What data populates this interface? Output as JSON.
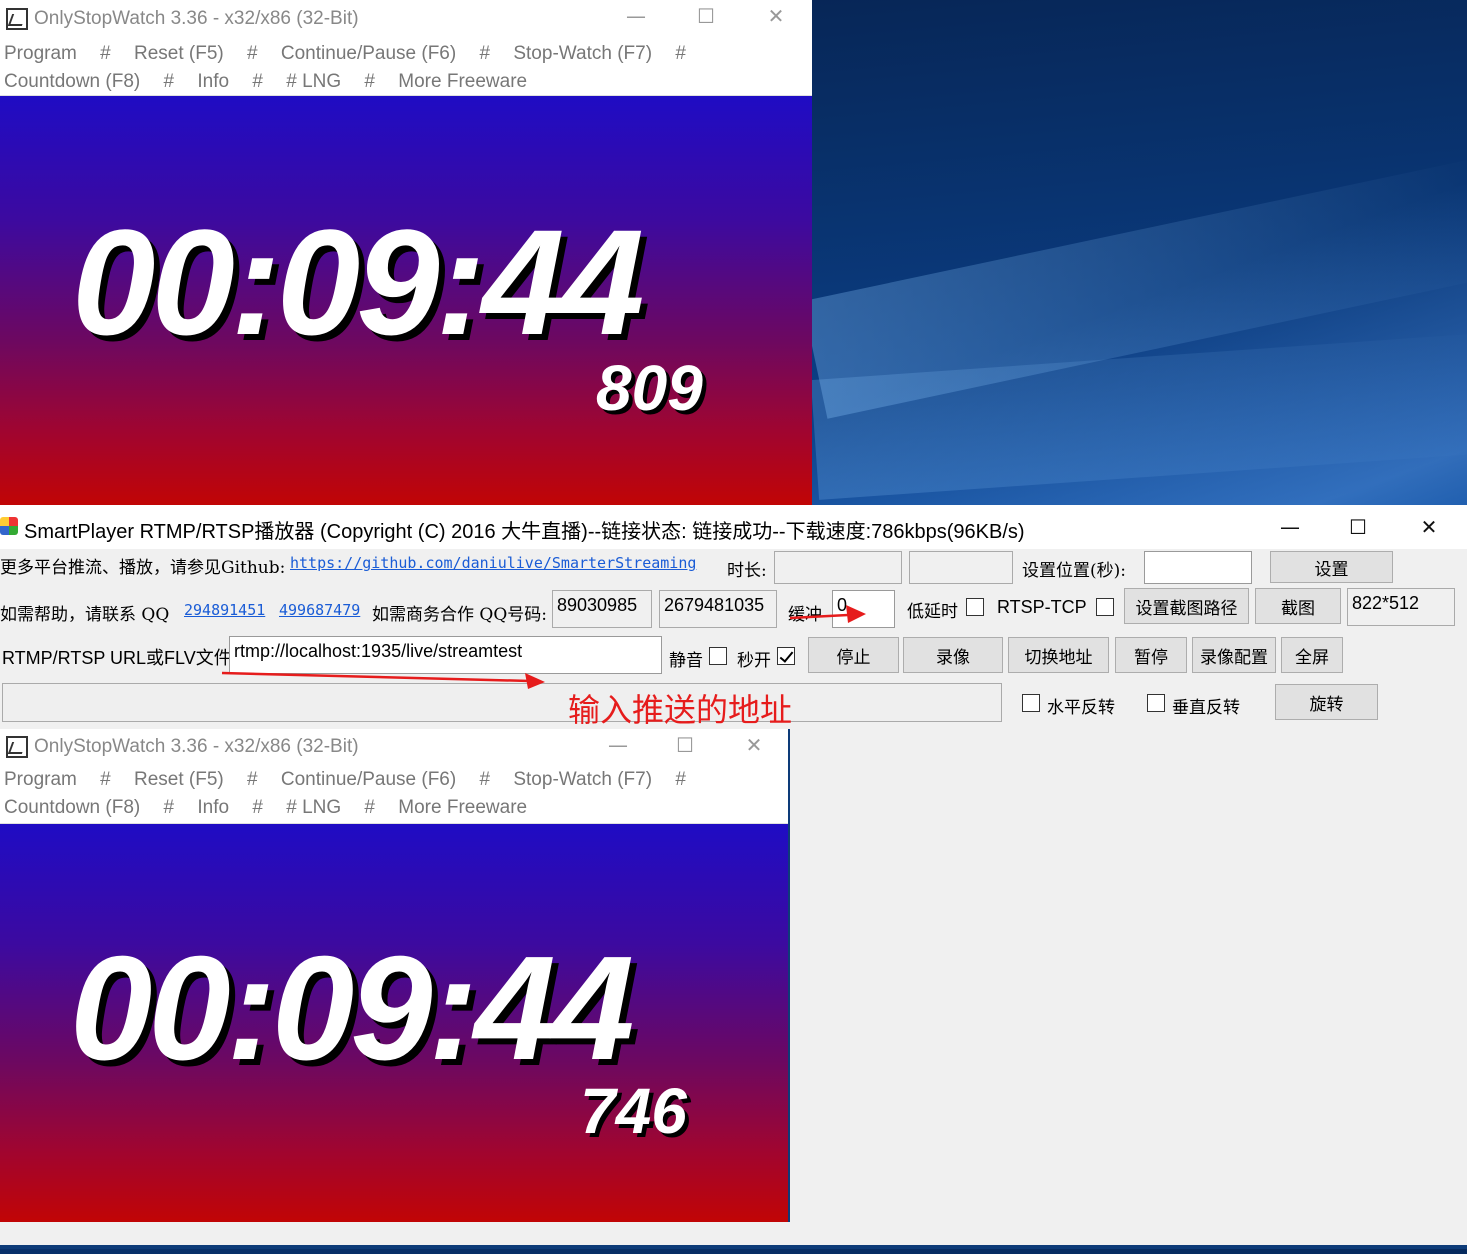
{
  "win1": {
    "title": "OnlyStopWatch 3.36 - x32/x86 (32-Bit)",
    "menu_line1": [
      "Program",
      "#",
      "Reset  (F5)",
      "#",
      "Continue/Pause (F6)",
      "#",
      "Stop-Watch  (F7)",
      "#"
    ],
    "menu_line2": [
      "Countdown  (F8)",
      "#",
      "Info",
      "#",
      "# LNG",
      "#",
      "More Freeware"
    ],
    "time": "00:09:44",
    "ms": "809"
  },
  "win2": {
    "title": "OnlyStopWatch 3.36 - x32/x86 (32-Bit)",
    "menu_line1": [
      "Program",
      "#",
      "Reset  (F5)",
      "#",
      "Continue/Pause (F6)",
      "#",
      "Stop-Watch  (F7)",
      "#"
    ],
    "menu_line2": [
      "Countdown  (F8)",
      "#",
      "Info",
      "#",
      "# LNG",
      "#",
      "More Freeware"
    ],
    "time": "00:09:44",
    "ms": "746"
  },
  "player": {
    "title": "SmartPlayer RTMP/RTSP播放器 (Copyright (C) 2016 大牛直播)--链接状态: 链接成功--下载速度:786kbps(96KB/s)",
    "github_label": "更多平台推流、播放，请参见Github:",
    "github_link": "https://github.com/daniulive/SmarterStreaming",
    "duration_label": "时长:",
    "duration_value": "",
    "duration_value2": "",
    "set_pos_label": "设置位置(秒):",
    "set_pos_value": "",
    "set_button": "设置",
    "help_label": "如需帮助，请联系 QQ",
    "qq1": "294891451",
    "qq2": "499687479",
    "biz_label": "如需商务合作 QQ号码:",
    "biz_qq1": "89030985",
    "biz_qq2": "2679481035",
    "buffer_label": "缓冲",
    "buffer_value": "0",
    "low_latency_label": "低延时",
    "rtsp_tcp_label": "RTSP-TCP",
    "set_snapshot_path_button": "设置截图路径",
    "snapshot_button": "截图",
    "resolution": "822*512",
    "url_label": "RTMP/RTSP URL或FLV文件:",
    "url_value": "rtmp://localhost:1935/live/streamtest",
    "mute_label": "静音",
    "instant_open_label": "秒开",
    "instant_open_checked": true,
    "stop_button": "停止",
    "record_button": "录像",
    "switch_url_button": "切换地址",
    "pause_button": "暂停",
    "record_config_button": "录像配置",
    "fullscreen_button": "全屏",
    "hflip_label": "水平反转",
    "vflip_label": "垂直反转",
    "rotate_button": "旋转",
    "annotation": "输入推送的地址"
  },
  "colors": {
    "annotation": "#e61c1c",
    "link": "#1a5cd6"
  }
}
